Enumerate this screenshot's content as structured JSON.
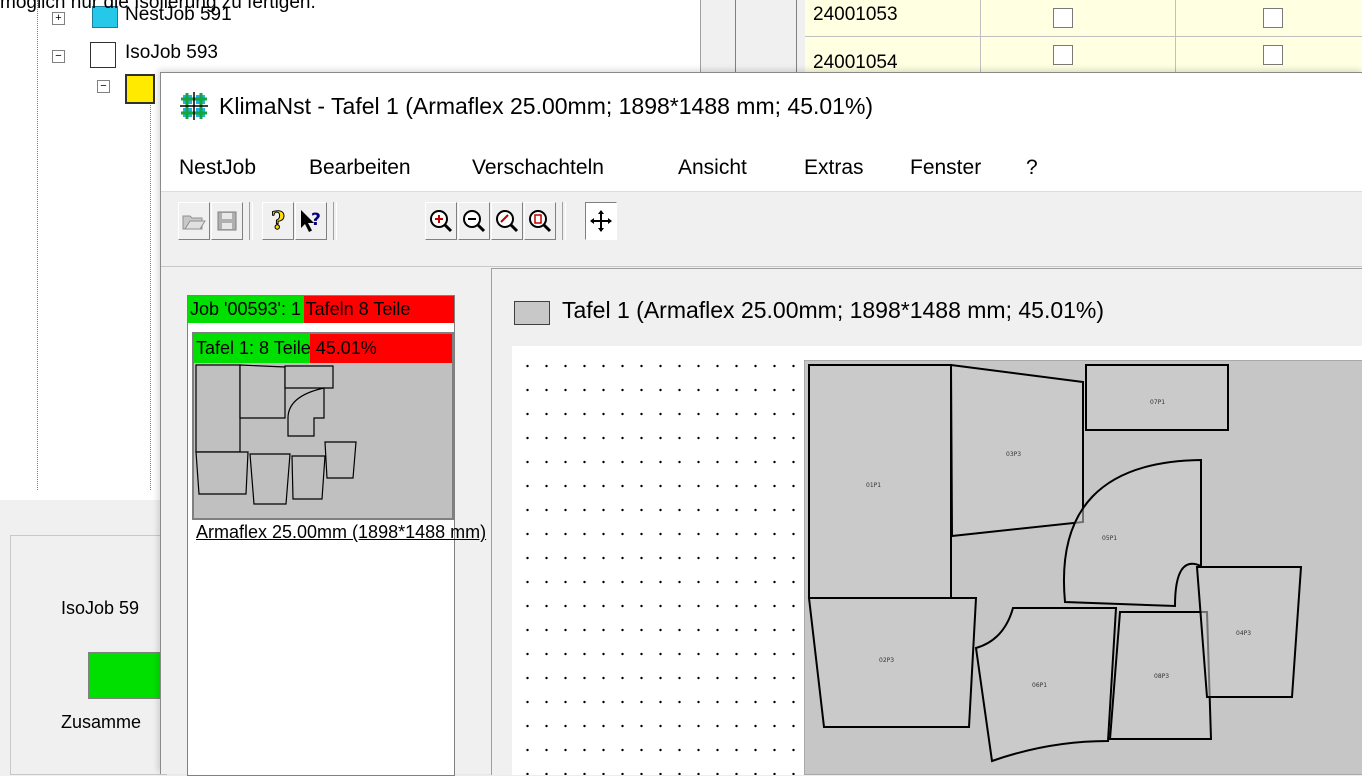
{
  "background": {
    "top_caption": "möglich nur die Isolierung zu fertigen.",
    "tree": [
      {
        "label": "NestJob 591",
        "expander": "+"
      },
      {
        "label": "IsoJob 593",
        "expander": "−"
      }
    ],
    "table_rows": [
      "24001053",
      "24001054"
    ],
    "panel_label": "IsoJob 59",
    "panel_caption": "Zusamme"
  },
  "window": {
    "title": "KlimaNst - Tafel 1 (Armaflex 25.00mm; 1898*1488 mm; 45.01%)",
    "app_icon": "klimanst-app-icon",
    "menu": [
      "NestJob",
      "Bearbeiten",
      "Verschachteln",
      "Ansicht",
      "Extras",
      "Fenster",
      "?"
    ],
    "toolbar": {
      "open": "open-folder-icon",
      "save": "save-disk-icon",
      "help": "help-question-icon",
      "context_help": "context-help-pointer-icon",
      "zoom_in": "zoom-in-icon",
      "zoom_out": "zoom-out-icon",
      "zoom_all": "zoom-fit-icon",
      "zoom_page": "zoom-page-icon",
      "move": "move-arrows-icon"
    }
  },
  "job_panel": {
    "header": "Job '00593': 1 Tafeln 8 Teile",
    "plate_header": "Tafel 1: 8 Teile 45.01%",
    "plate_label": "Armaflex 25.00mm (1898*1488 mm)"
  },
  "sheet_window": {
    "title": "Tafel 1 (Armaflex 25.00mm; 1898*1488 mm; 45.01%)",
    "parts": [
      "01P1",
      "03P3",
      "07P1",
      "05P1",
      "02P3",
      "06P1",
      "08P3",
      "04P3"
    ]
  },
  "colors": {
    "progress_green": "#00e000",
    "status_red": "#ff0000",
    "sheet_gray": "#c0c0c0"
  }
}
